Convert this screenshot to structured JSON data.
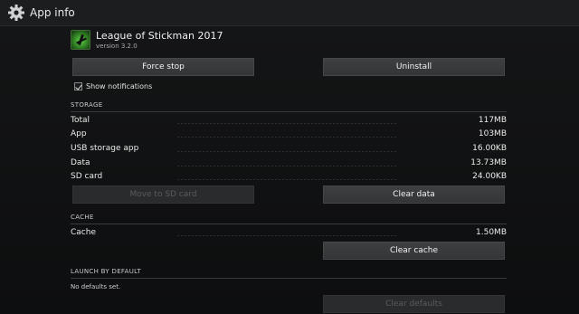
{
  "actionbar": {
    "title": "App info",
    "icon": "gear-icon"
  },
  "app": {
    "name": "League of Stickman 2017",
    "version": "version 3.2.0",
    "icon": "stickman-app-icon"
  },
  "buttons": {
    "force_stop": "Force stop",
    "uninstall": "Uninstall",
    "move_to_sd": "Move to SD card",
    "clear_data": "Clear data",
    "clear_cache": "Clear cache",
    "clear_defaults": "Clear defaults"
  },
  "notifications": {
    "label": "Show notifications",
    "checked": true
  },
  "storage": {
    "header": "STORAGE",
    "rows": [
      {
        "label": "Total",
        "value": "117MB"
      },
      {
        "label": "App",
        "value": "103MB"
      },
      {
        "label": "USB storage app",
        "value": "16.00KB"
      },
      {
        "label": "Data",
        "value": "13.73MB"
      },
      {
        "label": "SD card",
        "value": "24.00KB"
      }
    ]
  },
  "cache": {
    "header": "CACHE",
    "rows": [
      {
        "label": "Cache",
        "value": "1.50MB"
      }
    ]
  },
  "launch": {
    "header": "LAUNCH BY DEFAULT",
    "text": "No defaults set."
  }
}
